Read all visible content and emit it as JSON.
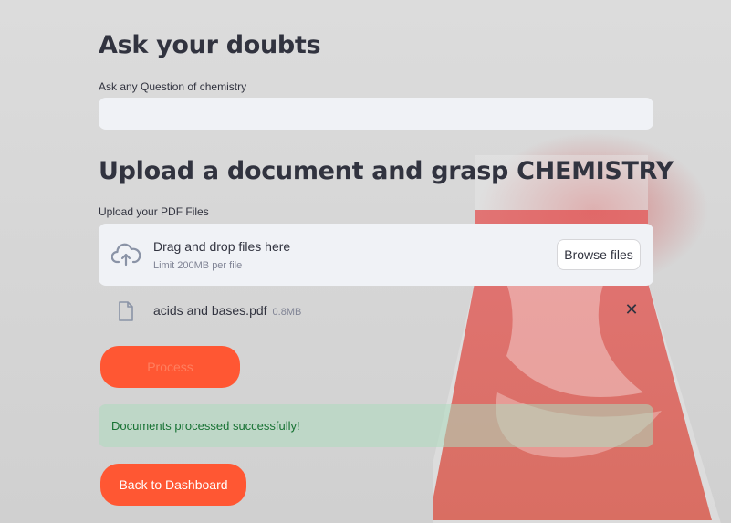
{
  "ask_section": {
    "heading": "Ask your doubts",
    "question_label": "Ask any Question of chemistry",
    "question_value": "",
    "question_placeholder": ""
  },
  "upload_section": {
    "heading": "Upload a document and grasp CHEMISTRY",
    "upload_label": "Upload your PDF Files",
    "dropzone": {
      "title": "Drag and drop files here",
      "subtitle": "Limit 200MB per file",
      "browse_label": "Browse files",
      "icon": "cloud-upload-icon"
    },
    "uploaded_file": {
      "name": "acids and bases.pdf",
      "size": "0.8MB",
      "icon": "file-icon",
      "remove_icon": "close-icon"
    },
    "process_button_label": "Process"
  },
  "status": {
    "success_message": "Documents processed successfully!"
  },
  "navigation": {
    "dashboard_button_label": "Back to Dashboard"
  },
  "colors": {
    "primary_button": "#ff5733",
    "success_text": "#177233",
    "input_bg": "#f0f2f6"
  }
}
